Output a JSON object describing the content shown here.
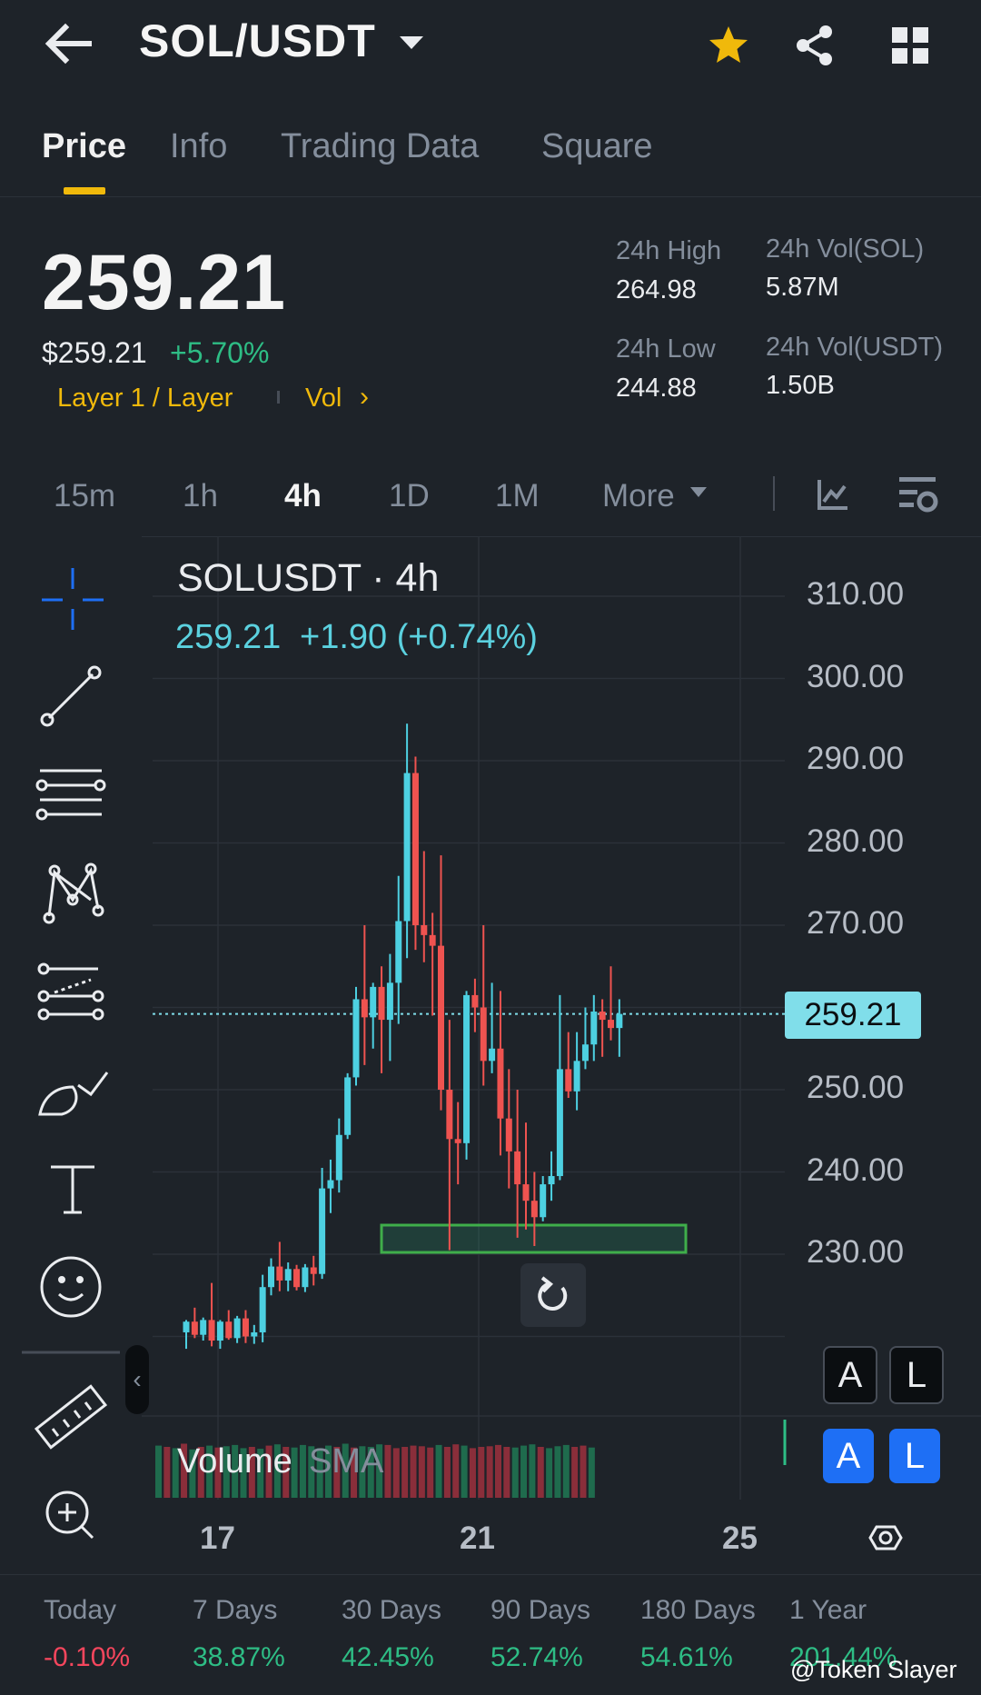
{
  "header": {
    "pair": "SOL/USDT"
  },
  "tabs": [
    "Price",
    "Info",
    "Trading Data",
    "Square"
  ],
  "price": {
    "last": "259.21",
    "usd": "$259.21",
    "change_pct": "+5.70%",
    "tag_category": "Layer 1 / Layer",
    "tag_vol": "Vol"
  },
  "stats": {
    "high_label": "24h High",
    "high_value": "264.98",
    "low_label": "24h Low",
    "low_value": "244.88",
    "vol_sol_label": "24h Vol(SOL)",
    "vol_sol_value": "5.87M",
    "vol_usdt_label": "24h Vol(USDT)",
    "vol_usdt_value": "1.50B"
  },
  "intervals": [
    "15m",
    "1h",
    "4h",
    "1D",
    "1M",
    "More"
  ],
  "active_interval": "4h",
  "chart": {
    "title": "SOLUSDT · 4h",
    "last_price": "259.21",
    "change": "+1.90 (+0.74%)",
    "price_tag": "259.21",
    "volume_label": "Volume",
    "volume_sma_label": "SMA",
    "buttons": {
      "auto": "A",
      "log": "L"
    }
  },
  "chart_data": {
    "type": "candlestick",
    "symbol": "SOLUSDT",
    "interval": "4h",
    "y_ticks": [
      "310.00",
      "300.00",
      "290.00",
      "280.00",
      "270.00",
      "250.00",
      "240.00",
      "230.00"
    ],
    "ylim": [
      216,
      315
    ],
    "x_ticks": [
      "17",
      "21",
      "25"
    ],
    "current_price": 259.21,
    "up_color": "#4dd0e1",
    "down_color": "#ef5350",
    "grid": true,
    "candles": [
      {
        "o": 220.5,
        "h": 222,
        "l": 218.5,
        "c": 221.8
      },
      {
        "o": 221.8,
        "h": 223.5,
        "l": 219.8,
        "c": 220.2
      },
      {
        "o": 220.2,
        "h": 222.3,
        "l": 219.5,
        "c": 222.0
      },
      {
        "o": 222.0,
        "h": 226.5,
        "l": 218.8,
        "c": 219.5
      },
      {
        "o": 219.5,
        "h": 222,
        "l": 218.5,
        "c": 221.8
      },
      {
        "o": 221.8,
        "h": 223.2,
        "l": 219.6,
        "c": 219.8
      },
      {
        "o": 219.8,
        "h": 222.5,
        "l": 219.2,
        "c": 222.2
      },
      {
        "o": 222.2,
        "h": 223.2,
        "l": 219.2,
        "c": 220.0
      },
      {
        "o": 220.0,
        "h": 221.4,
        "l": 219.1,
        "c": 220.5
      },
      {
        "o": 220.5,
        "h": 227.5,
        "l": 219.3,
        "c": 226.0
      },
      {
        "o": 226.0,
        "h": 229.5,
        "l": 225.0,
        "c": 228.5
      },
      {
        "o": 228.5,
        "h": 231.5,
        "l": 225.5,
        "c": 226.8
      },
      {
        "o": 226.8,
        "h": 229,
        "l": 225.5,
        "c": 228.2
      },
      {
        "o": 228.2,
        "h": 228.7,
        "l": 225.6,
        "c": 226.0
      },
      {
        "o": 226.0,
        "h": 228.8,
        "l": 225.4,
        "c": 228.4
      },
      {
        "o": 228.4,
        "h": 229.8,
        "l": 226.2,
        "c": 227.6
      },
      {
        "o": 227.6,
        "h": 240.5,
        "l": 227.0,
        "c": 238.0
      },
      {
        "o": 238.0,
        "h": 241.5,
        "l": 235.0,
        "c": 239.0
      },
      {
        "o": 239.0,
        "h": 246.5,
        "l": 237.5,
        "c": 244.5
      },
      {
        "o": 244.5,
        "h": 252.0,
        "l": 244.0,
        "c": 251.5
      },
      {
        "o": 251.5,
        "h": 262.5,
        "l": 250.5,
        "c": 261.0
      },
      {
        "o": 261.0,
        "h": 270.0,
        "l": 253.0,
        "c": 258.8
      },
      {
        "o": 258.8,
        "h": 263.0,
        "l": 255.0,
        "c": 262.5
      },
      {
        "o": 262.5,
        "h": 265.0,
        "l": 252.0,
        "c": 258.5
      },
      {
        "o": 258.5,
        "h": 266.5,
        "l": 253.5,
        "c": 263.0
      },
      {
        "o": 263.0,
        "h": 276.0,
        "l": 258.0,
        "c": 270.5
      },
      {
        "o": 270.5,
        "h": 294.5,
        "l": 266.0,
        "c": 288.5
      },
      {
        "o": 288.5,
        "h": 290.5,
        "l": 267.0,
        "c": 270.0
      },
      {
        "o": 270.0,
        "h": 279.0,
        "l": 265.5,
        "c": 268.8
      },
      {
        "o": 268.8,
        "h": 271.5,
        "l": 259.0,
        "c": 267.5
      },
      {
        "o": 267.5,
        "h": 278.5,
        "l": 247.5,
        "c": 250.0
      },
      {
        "o": 250.0,
        "h": 258.5,
        "l": 230.5,
        "c": 244.0
      },
      {
        "o": 244.0,
        "h": 248.5,
        "l": 238.5,
        "c": 243.5
      },
      {
        "o": 243.5,
        "h": 262.0,
        "l": 241.5,
        "c": 261.5
      },
      {
        "o": 261.5,
        "h": 263.5,
        "l": 257.0,
        "c": 260.0
      },
      {
        "o": 260.0,
        "h": 270.0,
        "l": 250.5,
        "c": 253.5
      },
      {
        "o": 253.5,
        "h": 263.0,
        "l": 252.0,
        "c": 255.0
      },
      {
        "o": 255.0,
        "h": 262.0,
        "l": 242.0,
        "c": 246.5
      },
      {
        "o": 246.5,
        "h": 252.5,
        "l": 238.0,
        "c": 242.5
      },
      {
        "o": 242.5,
        "h": 250.0,
        "l": 232.0,
        "c": 238.5
      },
      {
        "o": 238.5,
        "h": 246.0,
        "l": 233.0,
        "c": 236.5
      },
      {
        "o": 236.5,
        "h": 240.0,
        "l": 231.0,
        "c": 234.5
      },
      {
        "o": 234.5,
        "h": 239.5,
        "l": 234.0,
        "c": 238.5
      },
      {
        "o": 238.5,
        "h": 242.5,
        "l": 236.5,
        "c": 239.5
      },
      {
        "o": 239.5,
        "h": 261.5,
        "l": 239.0,
        "c": 252.5
      },
      {
        "o": 252.5,
        "h": 257.0,
        "l": 249.0,
        "c": 249.8
      },
      {
        "o": 249.8,
        "h": 257.0,
        "l": 247.5,
        "c": 253.5
      },
      {
        "o": 253.5,
        "h": 260.0,
        "l": 252.5,
        "c": 255.5
      },
      {
        "o": 255.5,
        "h": 261.5,
        "l": 253.5,
        "c": 259.5
      },
      {
        "o": 259.5,
        "h": 261.0,
        "l": 254.0,
        "c": 258.5
      },
      {
        "o": 258.5,
        "h": 265.0,
        "l": 256.0,
        "c": 257.5
      },
      {
        "o": 257.5,
        "h": 261.0,
        "l": 254.0,
        "c": 259.21
      }
    ],
    "volume_up_ratio_note": "",
    "volumes": [
      0.82,
      0.8,
      0.78,
      0.85,
      0.76,
      0.8,
      0.82,
      0.79,
      0.81,
      0.83,
      0.78,
      0.8,
      0.77,
      0.82,
      0.84,
      0.8,
      0.79,
      0.83,
      0.81,
      0.78,
      0.82,
      0.8,
      0.85,
      0.79,
      0.81,
      0.8,
      0.84,
      0.83,
      0.78,
      0.8,
      0.82,
      0.81,
      0.79,
      0.83,
      0.8,
      0.84,
      0.82,
      0.78,
      0.8,
      0.81,
      0.83,
      0.8,
      0.79,
      0.82,
      0.84,
      0.8,
      0.78,
      0.81,
      0.83,
      0.8,
      0.82,
      0.79
    ]
  },
  "periods": [
    {
      "label": "Today",
      "value": "-0.10%",
      "color": "#f6465d"
    },
    {
      "label": "7 Days",
      "value": "38.87%",
      "color": "#2ebd85"
    },
    {
      "label": "30 Days",
      "value": "42.45%",
      "color": "#2ebd85"
    },
    {
      "label": "90 Days",
      "value": "52.74%",
      "color": "#2ebd85"
    },
    {
      "label": "180 Days",
      "value": "54.61%",
      "color": "#2ebd85"
    },
    {
      "label": "1 Year",
      "value": "201.44%",
      "color": "#2ebd85"
    }
  ],
  "watermark": "@Token Slayer"
}
